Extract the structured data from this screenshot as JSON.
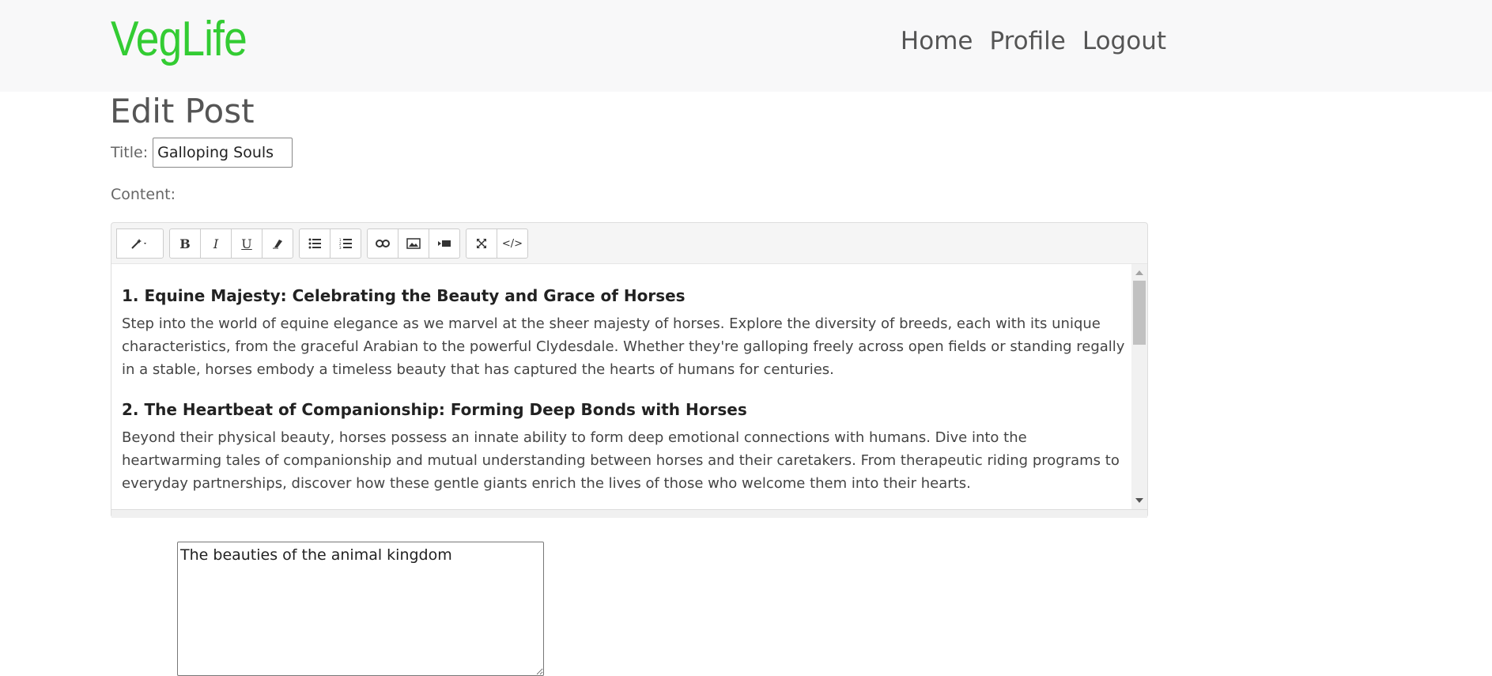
{
  "brand": {
    "name": "VegLife"
  },
  "nav": {
    "items": [
      {
        "label": "Home"
      },
      {
        "label": "Profile"
      },
      {
        "label": "Logout"
      }
    ]
  },
  "page": {
    "title": "Edit Post",
    "title_label": "Title:",
    "title_value": "Galloping Souls",
    "content_label": "Content:"
  },
  "toolbar": {
    "groups": [
      {
        "name": "style",
        "buttons": [
          {
            "icon": "magic-wand-icon",
            "glyph": "🪄"
          }
        ]
      },
      {
        "name": "font",
        "buttons": [
          {
            "icon": "bold-icon",
            "glyph": "B"
          },
          {
            "icon": "italic-icon",
            "glyph": "I"
          },
          {
            "icon": "underline-icon",
            "glyph": "U"
          },
          {
            "icon": "eraser-icon",
            "glyph": "⌫"
          }
        ]
      },
      {
        "name": "para",
        "buttons": [
          {
            "icon": "unordered-list-icon",
            "glyph": "☰"
          },
          {
            "icon": "ordered-list-icon",
            "glyph": "≡"
          }
        ]
      },
      {
        "name": "insert",
        "buttons": [
          {
            "icon": "link-icon",
            "glyph": "🔗"
          },
          {
            "icon": "image-icon",
            "glyph": "▣"
          },
          {
            "icon": "video-icon",
            "glyph": "▶"
          }
        ]
      },
      {
        "name": "view",
        "buttons": [
          {
            "icon": "fullscreen-icon",
            "glyph": "⤢"
          },
          {
            "icon": "code-view-icon",
            "glyph": "</>"
          }
        ]
      }
    ]
  },
  "editor": {
    "sections": [
      {
        "heading": "1. Equine Majesty: Celebrating the Beauty and Grace of Horses",
        "body": "Step into the world of equine elegance as we marvel at the sheer majesty of horses. Explore the diversity of breeds, each with its unique characteristics, from the graceful Arabian to the powerful Clydesdale. Whether they're galloping freely across open fields or standing regally in a stable, horses embody a timeless beauty that has captured the hearts of humans for centuries."
      },
      {
        "heading": "2. The Heartbeat of Companionship: Forming Deep Bonds with Horses",
        "body": "Beyond their physical beauty, horses possess an innate ability to form deep emotional connections with humans. Dive into the heartwarming tales of companionship and mutual understanding between horses and their caretakers. From therapeutic riding programs to everyday partnerships, discover how these gentle giants enrich the lives of those who welcome them into their hearts."
      }
    ]
  },
  "description": {
    "value": "The beauties of the animal kingdom"
  },
  "colors": {
    "brand": "#33cc33",
    "navbar_bg": "#f8f8f9"
  }
}
